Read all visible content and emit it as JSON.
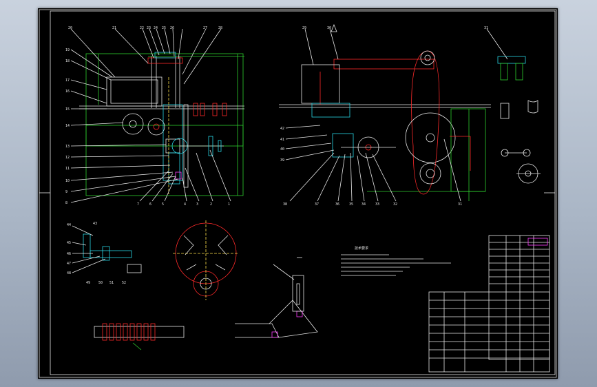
{
  "colors": {
    "viewport_bg": "#b4bfcd",
    "sheet": "#000000",
    "line_white": "#e8e8e8",
    "line_green": "#2fd02f",
    "line_red": "#ff2a2a",
    "line_cyan": "#29d7e6",
    "line_magenta": "#ff3cff"
  },
  "front_view": {
    "top_callouts": [
      "20",
      "21",
      "22",
      "23",
      "24",
      "25",
      "26",
      "27",
      "28"
    ],
    "left_callouts": [
      "19",
      "18",
      "17",
      "16",
      "15",
      "14",
      "13",
      "12",
      "11",
      "10",
      "9",
      "8"
    ],
    "bottom_callouts": [
      "7",
      "6",
      "5",
      "4",
      "3",
      "2",
      "1"
    ]
  },
  "side_view": {
    "top_callouts": [
      "29",
      "30"
    ],
    "left_callouts": [
      "42",
      "41",
      "40",
      "39"
    ],
    "bottom_callouts": [
      "38",
      "37",
      "36",
      "35",
      "34",
      "33",
      "32",
      "31"
    ]
  },
  "detail_a": {
    "callout": "31"
  },
  "detail_views": {
    "gear_section": {
      "callouts": [
        "43",
        "44",
        "45",
        "46",
        "47",
        "48",
        "49",
        "50",
        "51",
        "52"
      ]
    }
  },
  "notes_title": "技术要求",
  "icons": [
    "north-arrow-icon"
  ]
}
